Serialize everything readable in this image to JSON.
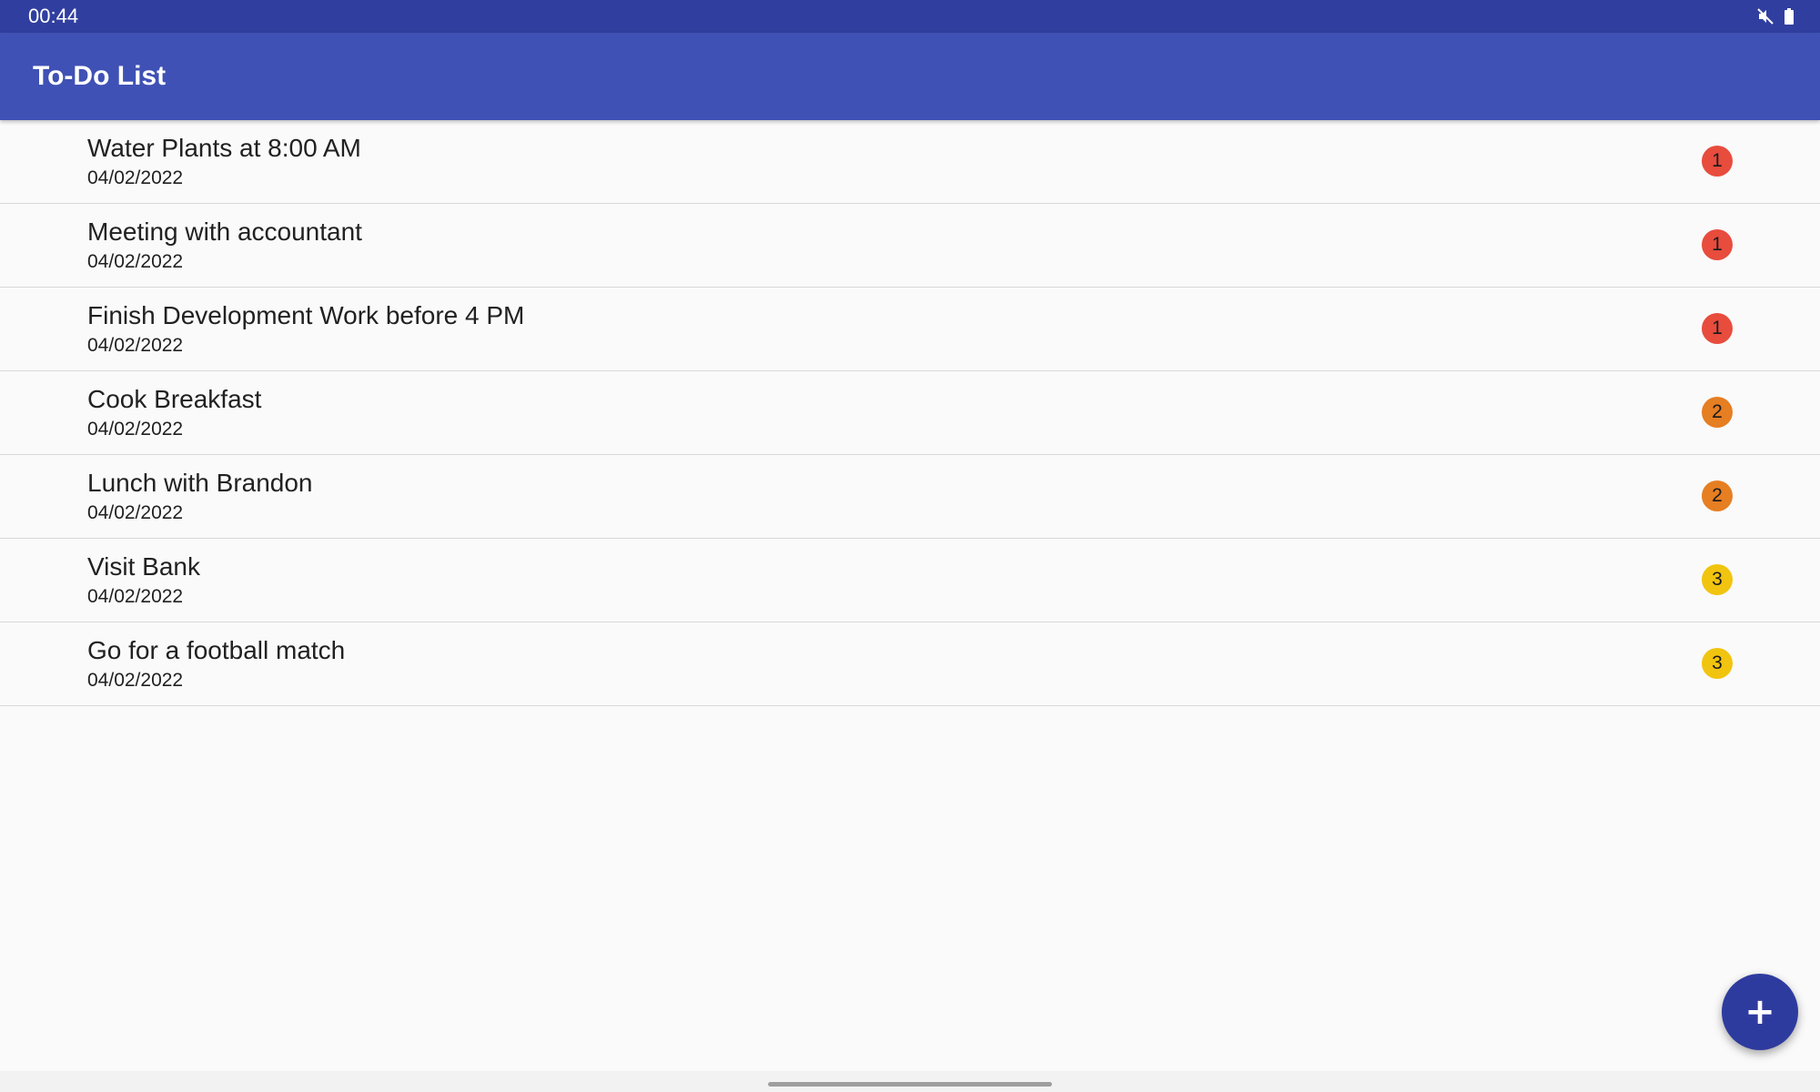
{
  "status_bar": {
    "time": "00:44",
    "icons": [
      "mute-icon",
      "battery-icon"
    ]
  },
  "app_bar": {
    "title": "To-Do List"
  },
  "colors": {
    "app_bar": "#3f51b5",
    "status_bar": "#303f9f",
    "fab": "#2e3b9e",
    "priority_1": "#e84c3d",
    "priority_2": "#e67e22",
    "priority_3": "#f1c40f"
  },
  "todos": [
    {
      "title": "Water Plants at 8:00 AM",
      "date": "04/02/2022",
      "priority": "1"
    },
    {
      "title": "Meeting with accountant",
      "date": "04/02/2022",
      "priority": "1"
    },
    {
      "title": "Finish Development Work before 4 PM",
      "date": "04/02/2022",
      "priority": "1"
    },
    {
      "title": "Cook Breakfast",
      "date": "04/02/2022",
      "priority": "2"
    },
    {
      "title": "Lunch with Brandon",
      "date": "04/02/2022",
      "priority": "2"
    },
    {
      "title": "Visit Bank",
      "date": "04/02/2022",
      "priority": "3"
    },
    {
      "title": "Go for a football match",
      "date": "04/02/2022",
      "priority": "3"
    }
  ],
  "fab": {
    "label": "+",
    "icon": "add-icon"
  }
}
